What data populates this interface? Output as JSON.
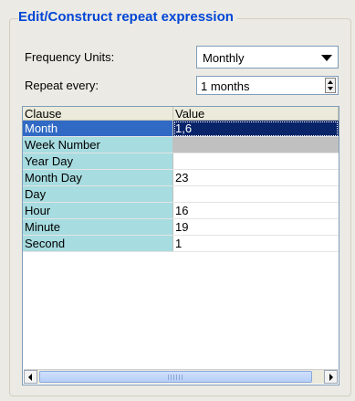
{
  "group": {
    "title": "Edit/Construct repeat expression"
  },
  "frequency": {
    "label": "Frequency Units:",
    "value": "Monthly"
  },
  "repeat": {
    "label": "Repeat every:",
    "value": "1 months"
  },
  "table": {
    "headers": [
      "Clause",
      "Value"
    ],
    "rows": [
      {
        "clause": "Month",
        "value": "1,6"
      },
      {
        "clause": "Week Number",
        "value": ""
      },
      {
        "clause": "Year Day",
        "value": ""
      },
      {
        "clause": "Month Day",
        "value": "23"
      },
      {
        "clause": "Day",
        "value": ""
      },
      {
        "clause": "Hour",
        "value": "16"
      },
      {
        "clause": "Minute",
        "value": "19"
      },
      {
        "clause": "Second",
        "value": "1"
      }
    ]
  },
  "colors": {
    "title": "#0046d5",
    "clause_bg": "#a7dce0",
    "selected": "#316ac5"
  }
}
